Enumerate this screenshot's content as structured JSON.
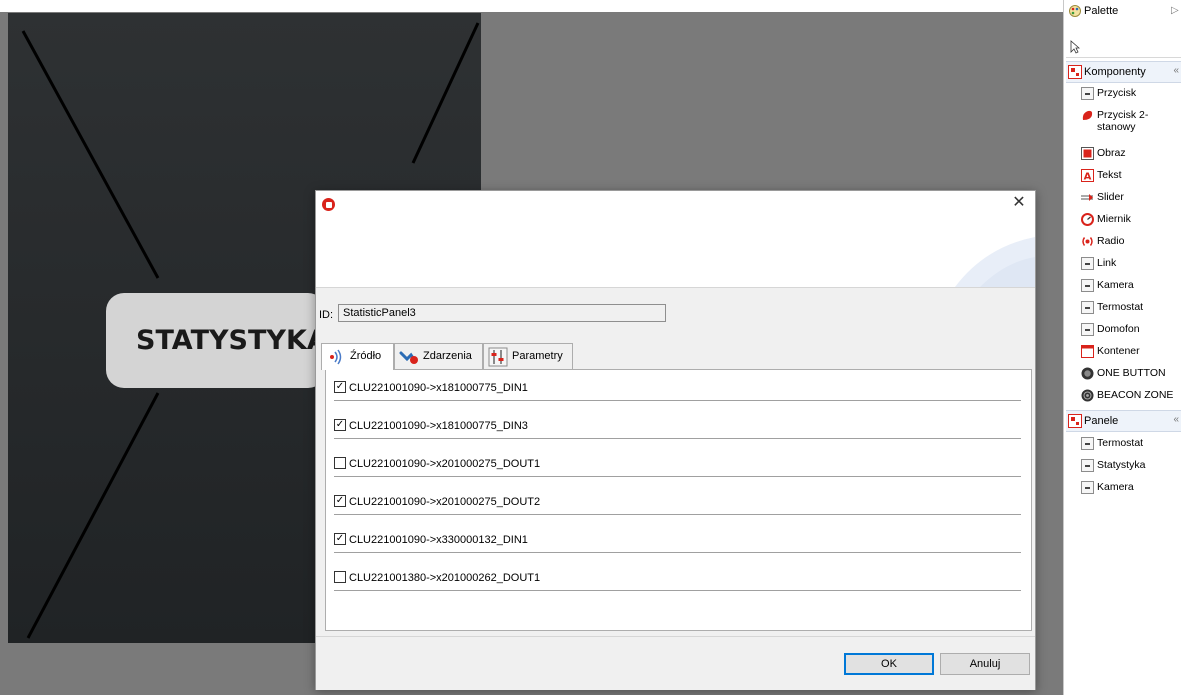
{
  "canvas": {
    "panel_label": "STATYSTYKA"
  },
  "dialog": {
    "close_glyph": "✕",
    "id_label": "ID:",
    "id_value": "StatisticPanel3",
    "tabs": [
      {
        "label": "Źródło",
        "icon": "source-icon",
        "active": true
      },
      {
        "label": "Zdarzenia",
        "icon": "events-icon",
        "active": false
      },
      {
        "label": "Parametry",
        "icon": "parameters-icon",
        "active": false
      }
    ],
    "sources": [
      {
        "label": "CLU221001090->x181000775_DIN1",
        "checked": true
      },
      {
        "label": "CLU221001090->x181000775_DIN3",
        "checked": true
      },
      {
        "label": "CLU221001090->x201000275_DOUT1",
        "checked": false
      },
      {
        "label": "CLU221001090->x201000275_DOUT2",
        "checked": true
      },
      {
        "label": "CLU221001090->x330000132_DIN1",
        "checked": true
      },
      {
        "label": "CLU221001380->x201000262_DOUT1",
        "checked": false
      }
    ],
    "ok_label": "OK",
    "cancel_label": "Anuluj"
  },
  "palette": {
    "title": "Palette",
    "drawers": {
      "components": "Komponenty",
      "panels": "Panele"
    },
    "component_items": [
      {
        "label": "Przycisk",
        "icon": "button-icon"
      },
      {
        "label": "Przycisk 2-",
        "icon": "toggle-button-icon"
      },
      {
        "label": "Obraz",
        "icon": "image-icon"
      },
      {
        "label": "Tekst",
        "icon": "text-icon"
      },
      {
        "label": "Slider",
        "icon": "slider-icon"
      },
      {
        "label": "Miernik",
        "icon": "gauge-icon"
      },
      {
        "label": "Radio",
        "icon": "radio-icon"
      },
      {
        "label": "Link",
        "icon": "link-icon"
      },
      {
        "label": "Kamera",
        "icon": "camera-icon"
      },
      {
        "label": "Termostat",
        "icon": "thermostat-icon"
      },
      {
        "label": "Domofon",
        "icon": "intercom-icon"
      },
      {
        "label": "Kontener",
        "icon": "container-icon"
      },
      {
        "label": "ONE BUTTON",
        "icon": "one-button-icon"
      },
      {
        "label": "BEACON ZONE",
        "icon": "beacon-zone-icon"
      }
    ],
    "toggle_second_line": "stanowy",
    "panel_items": [
      {
        "label": "Termostat",
        "icon": "thermostat-panel-icon"
      },
      {
        "label": "Statystyka",
        "icon": "statistics-panel-icon"
      },
      {
        "label": "Kamera",
        "icon": "camera-panel-icon"
      }
    ],
    "colors": {
      "accent_red": "#d9231b",
      "drawer_bg": "#eef3fa"
    }
  }
}
